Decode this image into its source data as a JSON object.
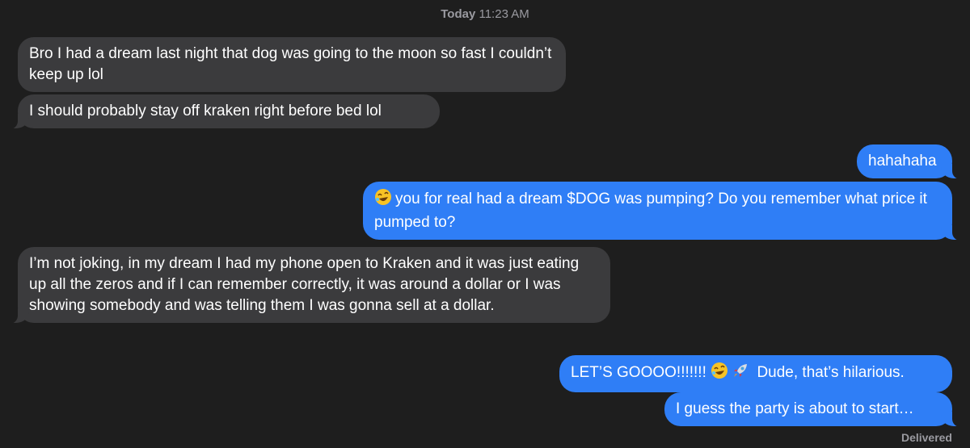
{
  "header": {
    "timestamp_day": "Today",
    "timestamp_time": "11:23 AM"
  },
  "messages": [
    {
      "direction": "incoming",
      "text": "Bro I had a dream last night that dog was going to the moon so fast I couldn’t keep up lol"
    },
    {
      "direction": "incoming",
      "text": "I should probably stay off kraken right before bed lol"
    },
    {
      "direction": "outgoing",
      "text": "hahahaha"
    },
    {
      "direction": "outgoing",
      "emoji": "rofl-emoji",
      "text": "you for real had a dream $DOG was pumping? Do you remember what price it pumped to?"
    },
    {
      "direction": "incoming",
      "text": "I’m not joking, in my dream I had my phone open to Kraken and it was just eating up all the zeros and if I can remember correctly, it was around a dollar or I was showing somebody and was telling them I was gonna sell at a dollar."
    },
    {
      "direction": "outgoing",
      "text_before": "LET’S GOOOO!!!!!!!",
      "emojis": [
        "rofl-emoji",
        "rocket-emoji"
      ],
      "text_after": "Dude, that’s hilarious."
    },
    {
      "direction": "outgoing",
      "text": "I guess the party is about to start…"
    }
  ],
  "status": {
    "delivered": "Delivered"
  },
  "colors": {
    "background": "#1e1e1e",
    "incoming_bubble": "#3b3b3d",
    "outgoing_bubble": "#2f7ef6",
    "meta_text": "#9a9aa0"
  }
}
